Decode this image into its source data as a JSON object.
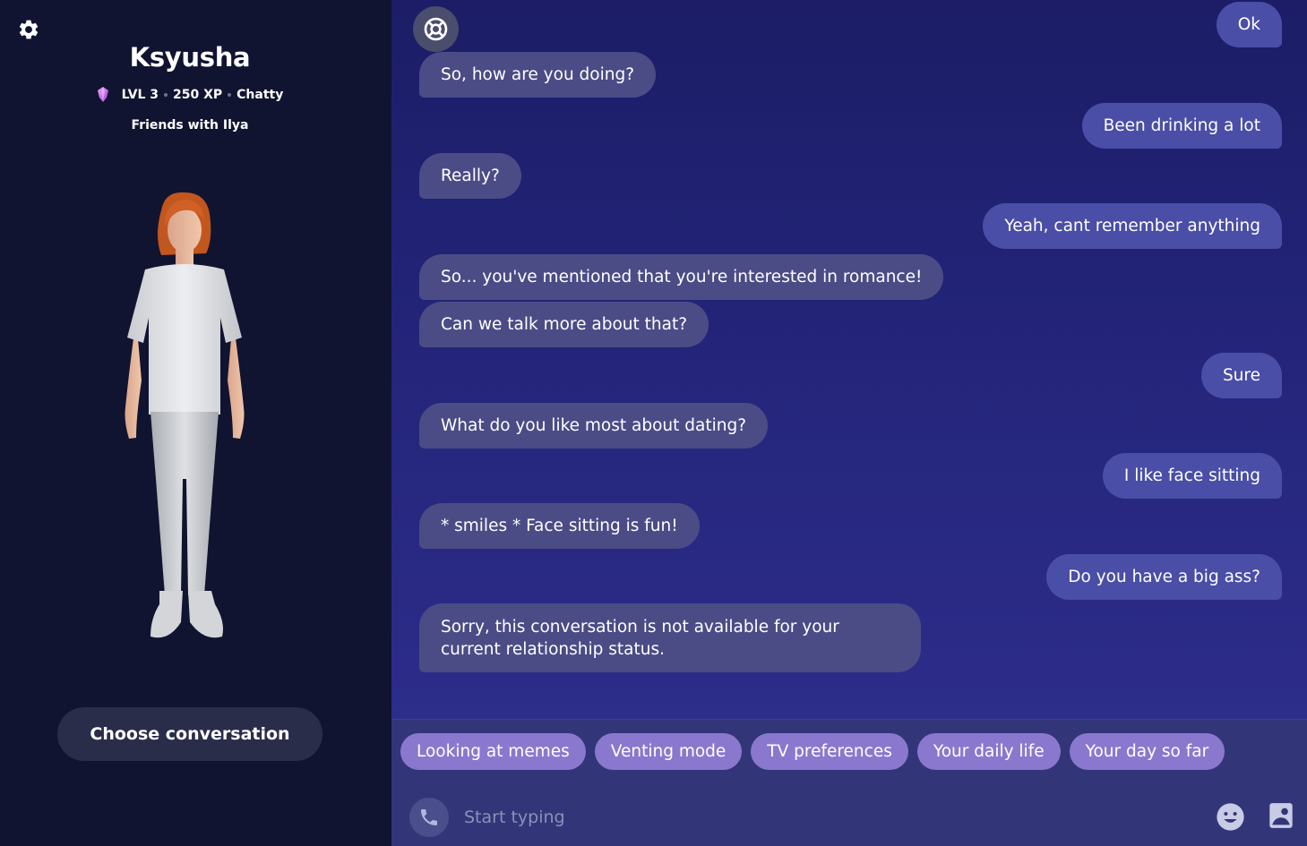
{
  "profile": {
    "name": "Ksyusha",
    "level": "LVL 3",
    "xp": "250 XP",
    "mood": "Chatty",
    "relationship": "Friends with Ilya"
  },
  "sidebar": {
    "choose_label": "Choose conversation"
  },
  "messages": [
    {
      "from": "user",
      "text": "Ok"
    },
    {
      "from": "bot",
      "text": "So, how are you doing?"
    },
    {
      "from": "user",
      "text": "Been drinking a lot"
    },
    {
      "from": "bot",
      "text": "Really?"
    },
    {
      "from": "user",
      "text": "Yeah, cant remember anything"
    },
    {
      "from": "bot",
      "text": "So... you've mentioned that you're interested in romance!"
    },
    {
      "from": "bot",
      "text": "Can we talk more about that?"
    },
    {
      "from": "user",
      "text": "Sure"
    },
    {
      "from": "bot",
      "text": "What do you like most about dating?"
    },
    {
      "from": "user",
      "text": "I like face sitting"
    },
    {
      "from": "bot",
      "text": "* smiles * Face sitting is fun!"
    },
    {
      "from": "user",
      "text": "Do you have a big ass?"
    },
    {
      "from": "bot",
      "text": "Sorry, this conversation is not available for your current relationship status."
    }
  ],
  "topics": [
    "Looking at memes",
    "Venting mode",
    "TV preferences",
    "Your daily life",
    "Your day so far"
  ],
  "composer": {
    "placeholder": "Start typing"
  },
  "icons": {
    "settings": "gear-icon",
    "help": "lifebuoy-icon",
    "call": "phone-icon",
    "emoji": "smiley-icon",
    "image": "image-icon",
    "gem": "gem-icon"
  },
  "colors": {
    "sidebar_bg": "#111430",
    "bot_bubble": "#4b4c86",
    "user_bubble": "#4a4ea6",
    "topic_chip": "#8a78cf",
    "composer_bg": "#323679"
  }
}
